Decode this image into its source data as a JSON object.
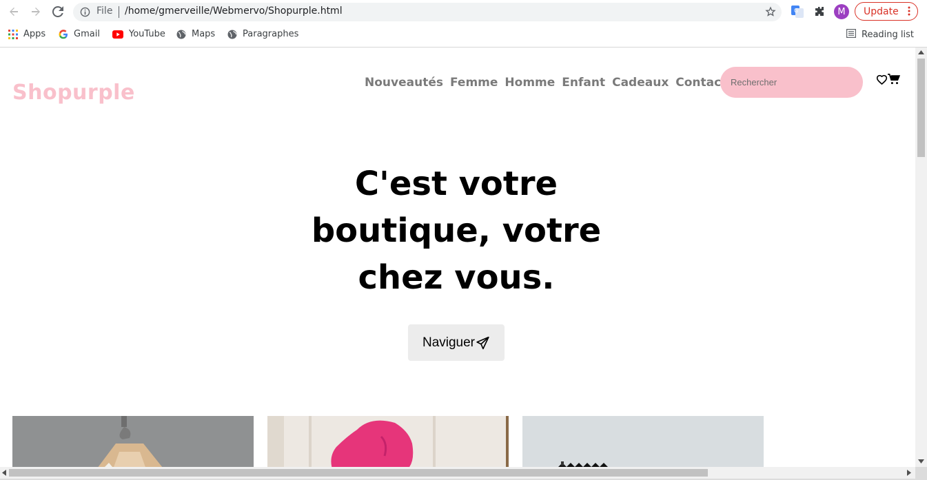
{
  "browser": {
    "url_scheme": "File",
    "url": "/home/gmerveille/Webmervo/Shopurple.html",
    "avatar_letter": "M",
    "update_label": "Update",
    "bookmarks": [
      {
        "label": "Apps",
        "icon": "apps-grid-icon"
      },
      {
        "label": "Gmail",
        "icon": "google-icon"
      },
      {
        "label": "YouTube",
        "icon": "youtube-icon"
      },
      {
        "label": "Maps",
        "icon": "globe-icon"
      },
      {
        "label": "Paragraphes",
        "icon": "globe-icon"
      }
    ],
    "reading_list_label": "Reading list"
  },
  "site": {
    "logo": "Shopurple",
    "nav": [
      "Nouveautés",
      "Femme",
      "Homme",
      "Enfant",
      "Cadeaux",
      "Contacts"
    ],
    "search_placeholder": "Rechercher",
    "hero_lines": [
      "C'est votre",
      "boutique, votre",
      "chez vous."
    ],
    "cta_label": "Naviguer",
    "colors": {
      "brand_pink": "#f9c0cb",
      "nav_grey": "#7a7a7a",
      "button_bg": "#ececec"
    }
  }
}
